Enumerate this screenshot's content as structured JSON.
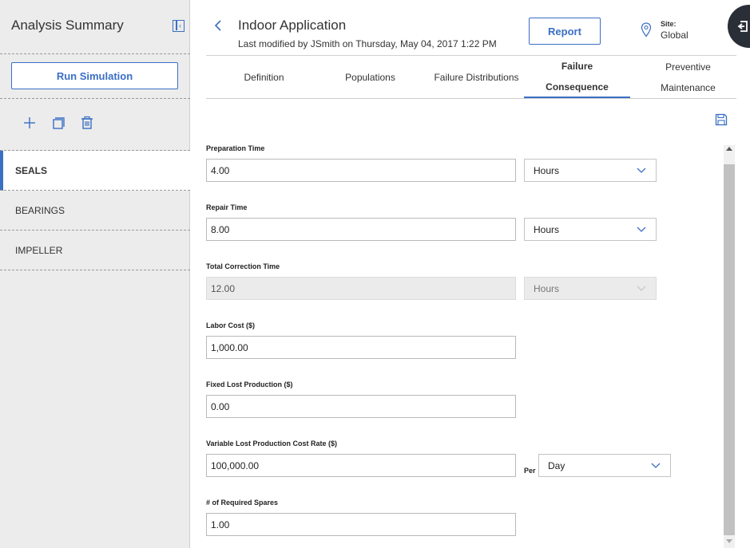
{
  "sidebar": {
    "title": "Analysis Summary",
    "run_label": "Run Simulation",
    "items": [
      {
        "label": "SEALS"
      },
      {
        "label": "BEARINGS"
      },
      {
        "label": "IMPELLER"
      }
    ]
  },
  "header": {
    "title": "Indoor Application",
    "subtitle": "Last modified by JSmith on Thursday, May 04, 2017 1:22 PM",
    "report_label": "Report",
    "site_label": "Site:",
    "site_value": "Global"
  },
  "tabs": [
    {
      "label": "Definition"
    },
    {
      "label": "Populations"
    },
    {
      "label": "Failure Distributions"
    },
    {
      "line1": "Failure",
      "line2": "Consequence"
    },
    {
      "line1": "Preventive",
      "line2": "Maintenance"
    }
  ],
  "form": {
    "prep_label": "Preparation Time",
    "prep_value": "4.00",
    "prep_unit": "Hours",
    "repair_label": "Repair Time",
    "repair_value": "8.00",
    "repair_unit": "Hours",
    "total_label": "Total Correction Time",
    "total_value": "12.00",
    "total_unit": "Hours",
    "labor_label": "Labor Cost ($)",
    "labor_value": "1,000.00",
    "fixed_label": "Fixed Lost Production ($)",
    "fixed_value": "0.00",
    "variable_label": "Variable Lost Production Cost Rate ($)",
    "variable_value": "100,000.00",
    "per_label": "Per",
    "per_unit": "Day",
    "spares_label": "# of Required Spares",
    "spares_value": "1.00"
  },
  "colors": {
    "accent": "#3a6fc4",
    "sidebar_bg": "#ececec",
    "corner_button": "#2a2e36"
  }
}
